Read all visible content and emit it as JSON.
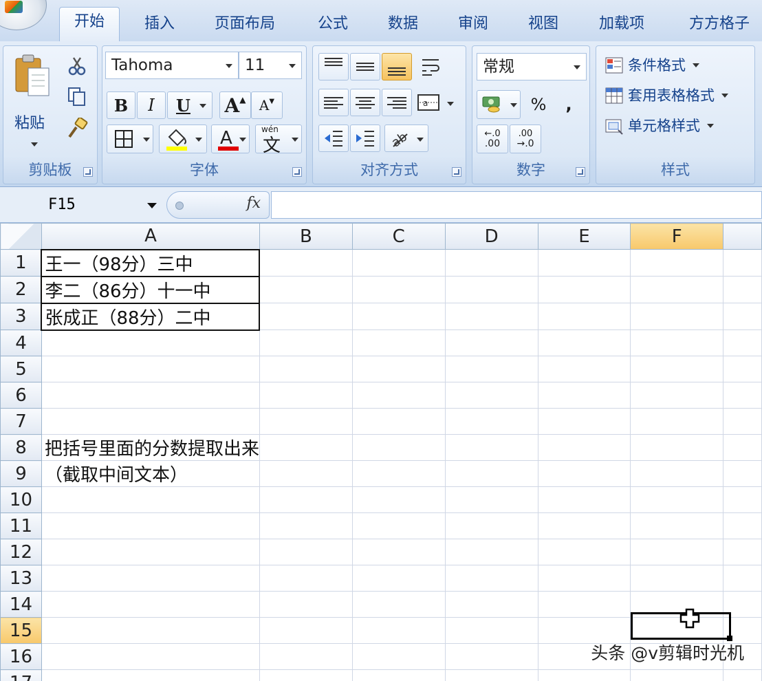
{
  "tabs": [
    "开始",
    "插入",
    "页面布局",
    "公式",
    "数据",
    "审阅",
    "视图",
    "加载项",
    "方方格子"
  ],
  "ribbon": {
    "clipboard": {
      "paste_label": "粘贴",
      "group_label": "剪贴板"
    },
    "font": {
      "font_name": "Tahoma",
      "font_size": "11",
      "bold": "B",
      "italic": "I",
      "underline": "U",
      "grow": "A",
      "shrink": "A",
      "wen": "wén",
      "wen_char": "文",
      "group_label": "字体",
      "fill_color": "#ffff00",
      "font_color": "#e00000"
    },
    "alignment": {
      "group_label": "对齐方式"
    },
    "number": {
      "format": "常规",
      "percent": "%",
      "comma": ",",
      "group_label": "数字",
      "inc_decimal": ".00",
      "dec_decimal": ".0"
    },
    "styles": {
      "conditional": "条件格式",
      "table_format": "套用表格格式",
      "cell_styles": "单元格样式",
      "group_label": "样式"
    }
  },
  "formula_bar": {
    "name_box": "F15",
    "fx": "fx",
    "formula": ""
  },
  "sheet": {
    "columns": [
      "A",
      "B",
      "C",
      "D",
      "E",
      "F"
    ],
    "rows": [
      "1",
      "2",
      "3",
      "4",
      "5",
      "6",
      "7",
      "8",
      "9",
      "10",
      "11",
      "12",
      "13",
      "14",
      "15",
      "16",
      "17"
    ],
    "cells": {
      "A1": "王一（98分）三中",
      "A2": "李二（86分）十一中",
      "A3": "张成正（88分）二中",
      "A8": "把括号里面的分数提取出来",
      "A9": "（截取中间文本）"
    },
    "active_cell": "F15"
  },
  "watermark": "头条 @v剪辑时光机"
}
